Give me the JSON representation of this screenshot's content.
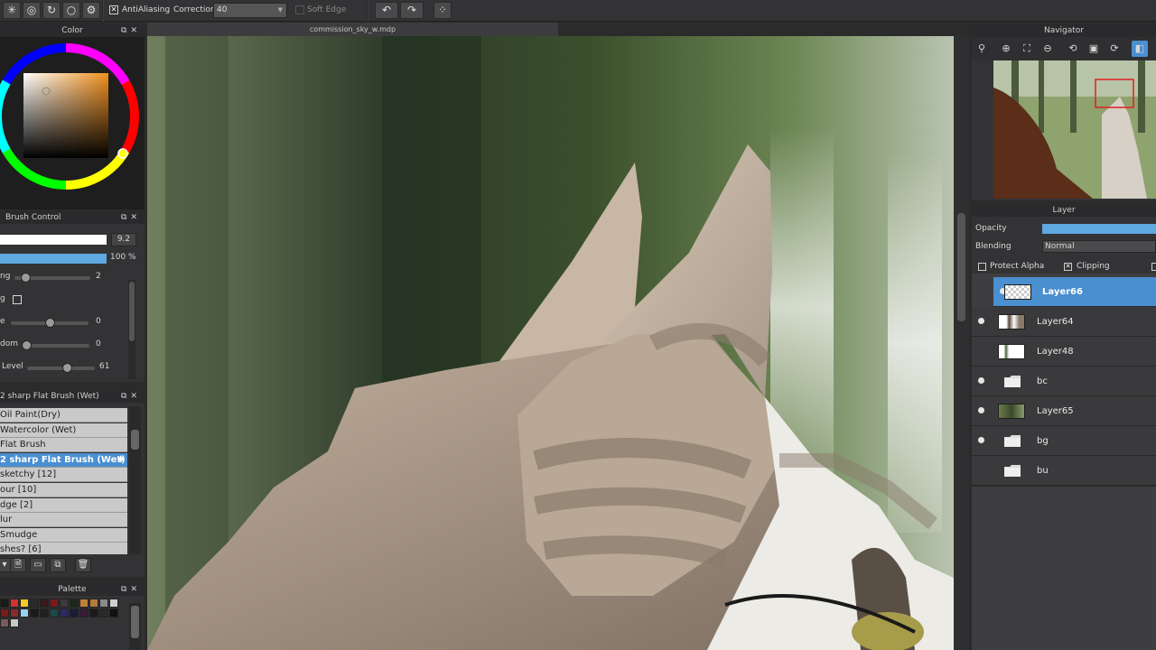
{
  "toolbar": {
    "antialiasing_label": "AntiAliasing",
    "antialiasing_checked": true,
    "correction_label": "Correction",
    "correction_value": "40",
    "soft_edge_label": "Soft Edge",
    "soft_edge_checked": false
  },
  "color_panel": {
    "title": "Color"
  },
  "brush_control": {
    "title": "Brush Control",
    "size_value": "9.2",
    "opacity_value": "100 %",
    "rows": [
      {
        "label": "ng",
        "value": "2",
        "level": 0.1
      },
      {
        "label": "g",
        "value": "",
        "level": null
      },
      {
        "label": "e",
        "value": "0",
        "level": 0.5
      },
      {
        "label": "dom",
        "value": "0",
        "level": 0.0
      },
      {
        "label": "Level",
        "value": "61",
        "level": 0.61
      }
    ]
  },
  "brush_list": {
    "title": "2 sharp Flat Brush (Wet)",
    "items": [
      {
        "label": "Oil Paint(Dry)",
        "selected": false
      },
      {
        "label": "Watercolor (Wet)",
        "selected": false
      },
      {
        "label": "Flat Brush",
        "selected": false
      },
      {
        "label": "2 sharp Flat Brush (Wet)",
        "selected": true
      },
      {
        "label": "sketchy [12]",
        "selected": false
      },
      {
        "label": "our [10]",
        "selected": false
      },
      {
        "label": "dge [2]",
        "selected": false
      },
      {
        "label": "lur",
        "selected": false
      },
      {
        "label": "Smudge",
        "selected": false
      },
      {
        "label": "shes? [6]",
        "selected": false
      }
    ]
  },
  "palette": {
    "title": "Palette",
    "colors": [
      "#1a1a1a",
      "#d32f2f",
      "#f9c825",
      "#2b2b2b",
      "#3a1a1a",
      "#7a1a1a",
      "#3b3b3b",
      "#1a2a1a",
      "#c0813c",
      "#b57a3b",
      "#8a8a8a",
      "#d0d0d0",
      "#7a1a1a",
      "#8a2a2a",
      "#9ad0f0",
      "#1a1a1a",
      "#202020",
      "#1a4a4a",
      "#2a2a6a",
      "#1a1a3a",
      "#3a1a3a",
      "#1a1a1a",
      "#2a2a2a",
      "#111111",
      "#7a5a5a",
      "#c8c8c8"
    ]
  },
  "canvas": {
    "document_title": "commission_sky_w.mdp"
  },
  "navigator": {
    "title": "Navigator"
  },
  "layer_panel": {
    "title": "Layer",
    "opacity_label": "Opacity",
    "opacity_level": 1.0,
    "blending_label": "Blending",
    "blending_value": "Normal",
    "protect_alpha_label": "Protect Alpha",
    "protect_alpha_checked": false,
    "clipping_label": "Clipping",
    "clipping_checked": true,
    "layers": [
      {
        "name": "Layer66",
        "type": "layer",
        "visible": true,
        "selected": true
      },
      {
        "name": "Layer64",
        "type": "layer",
        "visible": true,
        "selected": false
      },
      {
        "name": "Layer48",
        "type": "layer",
        "visible": false,
        "selected": false
      },
      {
        "name": "bc",
        "type": "folder",
        "visible": true,
        "selected": false
      },
      {
        "name": "Layer65",
        "type": "layer",
        "visible": true,
        "selected": false
      },
      {
        "name": "bg",
        "type": "folder",
        "visible": true,
        "selected": false
      },
      {
        "name": "bu",
        "type": "folder",
        "visible": false,
        "selected": false
      }
    ]
  }
}
